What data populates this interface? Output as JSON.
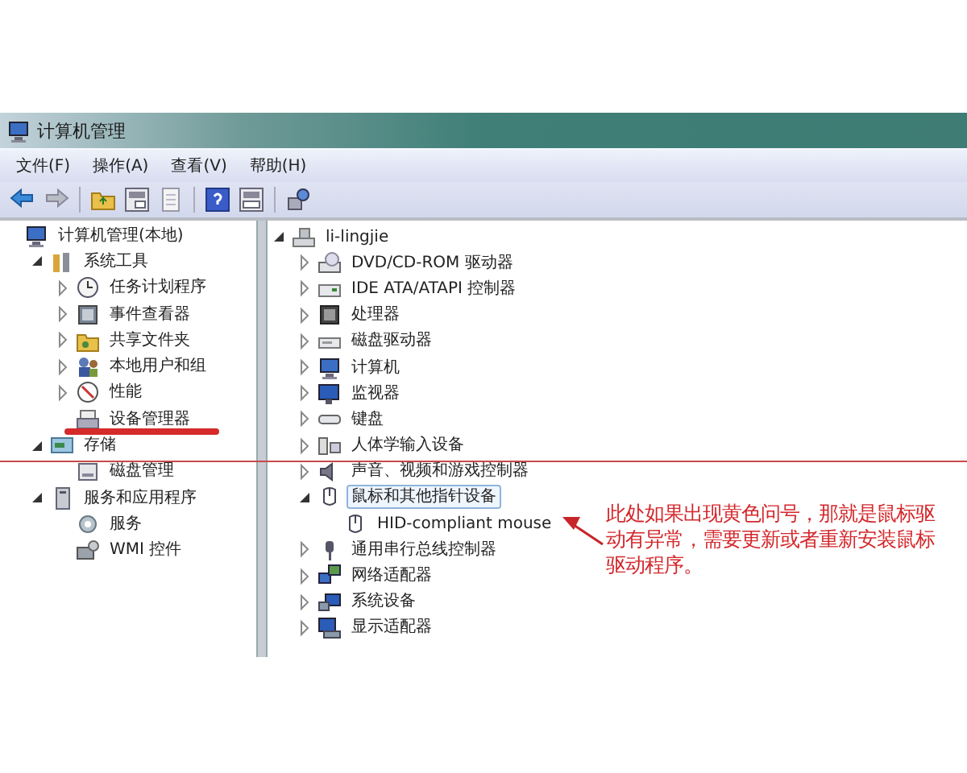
{
  "window": {
    "title": "计算机管理"
  },
  "menu": [
    "文件(F)",
    "操作(A)",
    "查看(V)",
    "帮助(H)"
  ],
  "left_tree": [
    {
      "label": "计算机管理(本地)",
      "selected": false,
      "children": [
        {
          "label": "系统工具",
          "expanded": true,
          "selected": false,
          "children": [
            {
              "label": "任务计划程序",
              "expanded": false,
              "selected": false
            },
            {
              "label": "事件查看器",
              "expanded": false,
              "selected": false
            },
            {
              "label": "共享文件夹",
              "expanded": false,
              "selected": false
            },
            {
              "label": "本地用户和组",
              "expanded": false,
              "selected": false
            },
            {
              "label": "性能",
              "expanded": false,
              "selected": false
            },
            {
              "label": "设备管理器",
              "selected": false
            }
          ]
        },
        {
          "label": "存储",
          "expanded": true,
          "selected": false,
          "children": [
            {
              "label": "磁盘管理",
              "selected": false
            }
          ]
        },
        {
          "label": "服务和应用程序",
          "expanded": true,
          "selected": false,
          "children": [
            {
              "label": "服务",
              "selected": false
            },
            {
              "label": "WMI 控件",
              "selected": false
            }
          ]
        }
      ]
    }
  ],
  "device_tree": [
    {
      "label": "li-lingjie",
      "expanded": true,
      "selected": false,
      "children": [
        {
          "label": "DVD/CD-ROM 驱动器",
          "expanded": false,
          "selected": false
        },
        {
          "label": "IDE ATA/ATAPI 控制器",
          "expanded": false,
          "selected": false
        },
        {
          "label": "处理器",
          "expanded": false,
          "selected": false
        },
        {
          "label": "磁盘驱动器",
          "expanded": false,
          "selected": false
        },
        {
          "label": "计算机",
          "expanded": false,
          "selected": false
        },
        {
          "label": "监视器",
          "expanded": false,
          "selected": false
        },
        {
          "label": "键盘",
          "expanded": false,
          "selected": false
        },
        {
          "label": "人体学输入设备",
          "expanded": false,
          "selected": false
        },
        {
          "label": "声音、视频和游戏控制器",
          "expanded": false,
          "selected": false
        },
        {
          "label": "鼠标和其他指针设备",
          "expanded": true,
          "selected": true,
          "children": [
            {
              "label": "HID-compliant mouse",
              "selected": false
            }
          ]
        },
        {
          "label": "通用串行总线控制器",
          "expanded": false,
          "selected": false
        },
        {
          "label": "网络适配器",
          "expanded": false,
          "selected": false
        },
        {
          "label": "系统设备",
          "expanded": false,
          "selected": false
        },
        {
          "label": "显示适配器",
          "expanded": false,
          "selected": false
        }
      ]
    }
  ],
  "annotation": {
    "note": "此处如果出现黄色问号，那就是鼠标驱动有异常，需要更新或者重新安装鼠标驱动程序。"
  }
}
